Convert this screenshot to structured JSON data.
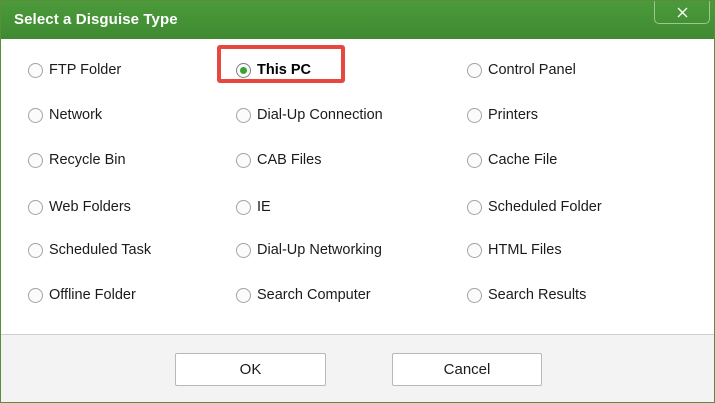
{
  "dialog": {
    "title": "Select a Disguise Type",
    "close_icon": "close-icon"
  },
  "options": [
    {
      "id": "ftp-folder",
      "label": "FTP Folder",
      "checked": false
    },
    {
      "id": "this-pc",
      "label": "This PC",
      "checked": true
    },
    {
      "id": "control-panel",
      "label": "Control Panel",
      "checked": false
    },
    {
      "id": "network",
      "label": "Network",
      "checked": false
    },
    {
      "id": "dial-up-connection",
      "label": "Dial-Up Connection",
      "checked": false
    },
    {
      "id": "printers",
      "label": "Printers",
      "checked": false
    },
    {
      "id": "recycle-bin",
      "label": "Recycle Bin",
      "checked": false
    },
    {
      "id": "cab-files",
      "label": "CAB Files",
      "checked": false
    },
    {
      "id": "cache-file",
      "label": "Cache File",
      "checked": false
    },
    {
      "id": "web-folders",
      "label": "Web Folders",
      "checked": false
    },
    {
      "id": "ie",
      "label": "IE",
      "checked": false
    },
    {
      "id": "scheduled-folder",
      "label": "Scheduled Folder",
      "checked": false
    },
    {
      "id": "scheduled-task",
      "label": "Scheduled Task",
      "checked": false
    },
    {
      "id": "dial-up-networking",
      "label": "Dial-Up Networking",
      "checked": false
    },
    {
      "id": "html-files",
      "label": "HTML Files",
      "checked": false
    },
    {
      "id": "offline-folder",
      "label": "Offline Folder",
      "checked": false
    },
    {
      "id": "search-computer",
      "label": "Search Computer",
      "checked": false
    },
    {
      "id": "search-results",
      "label": "Search Results",
      "checked": false
    }
  ],
  "buttons": {
    "ok_label": "OK",
    "cancel_label": "Cancel"
  },
  "colors": {
    "titlebar": "#45933a",
    "selected_dot": "#3aa334",
    "highlight_box": "#e8473f"
  }
}
